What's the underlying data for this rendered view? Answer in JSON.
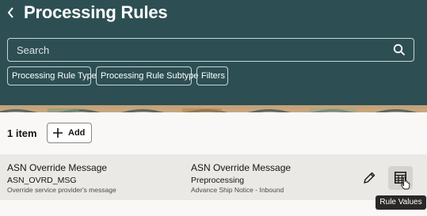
{
  "header": {
    "back_icon": "chevron-left-icon",
    "title": "Processing Rules"
  },
  "search": {
    "placeholder": "Search",
    "icon": "search-icon"
  },
  "filters": [
    {
      "label": "Processing Rule Type"
    },
    {
      "label": "Processing Rule Subtype"
    },
    {
      "label": "Filters"
    }
  ],
  "toolbar": {
    "count": "1 item",
    "add_label": "Add",
    "add_icon": "plus-icon"
  },
  "rows": [
    {
      "name": "ASN Override Message",
      "code": "ASN_OVRD_MSG",
      "description": "Override service provider's message",
      "type": "ASN Override Message",
      "subtype": "Preprocessing",
      "category": "Advance Ship Notice - Inbound",
      "edit_icon": "pencil-icon",
      "rule_values_icon": "table-icon"
    }
  ],
  "tooltip": "Rule Values"
}
